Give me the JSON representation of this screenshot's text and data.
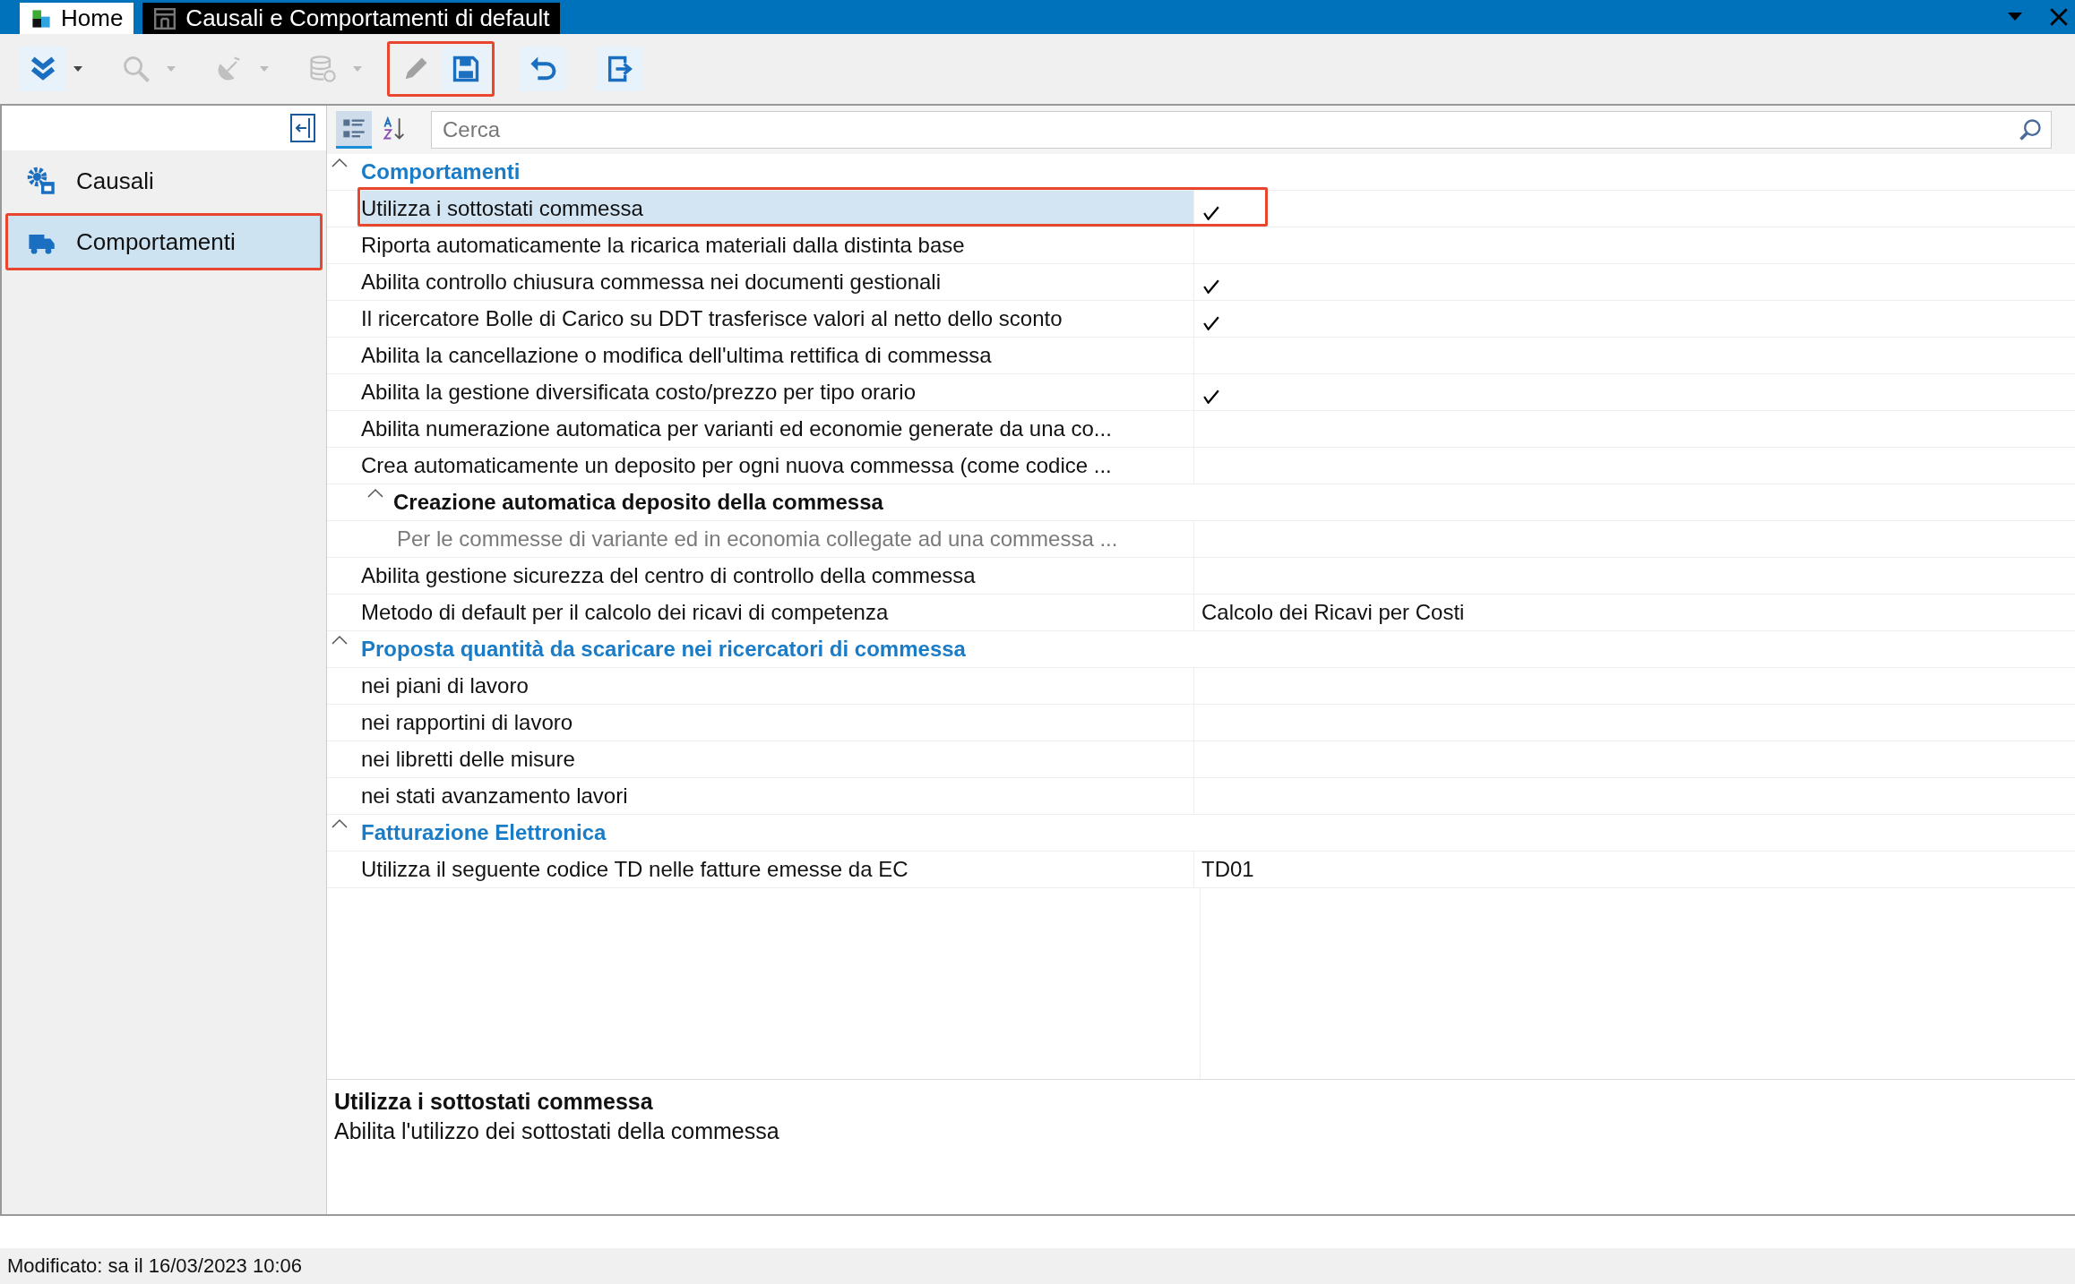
{
  "window": {
    "tabs": [
      {
        "label": "Home",
        "selected": false
      },
      {
        "label": "Causali e Comportamenti di default",
        "selected": true
      }
    ]
  },
  "toolbar": {
    "groups": [
      {
        "highlighted": false,
        "buttons": [
          {
            "kind": "expand",
            "dropdown": true,
            "disabled": false
          }
        ]
      },
      {
        "highlighted": false,
        "buttons": [
          {
            "kind": "search",
            "dropdown": true,
            "disabled": true
          }
        ]
      },
      {
        "highlighted": false,
        "buttons": [
          {
            "kind": "dish",
            "dropdown": true,
            "disabled": true
          }
        ]
      },
      {
        "highlighted": false,
        "buttons": [
          {
            "kind": "database",
            "dropdown": true,
            "disabled": true
          }
        ]
      },
      {
        "highlighted": true,
        "buttons": [
          {
            "kind": "edit",
            "disabled": true
          },
          {
            "kind": "save",
            "disabled": false
          }
        ]
      },
      {
        "highlighted": false,
        "buttons": [
          {
            "kind": "undo",
            "disabled": false
          }
        ]
      },
      {
        "highlighted": false,
        "buttons": [
          {
            "kind": "exit",
            "disabled": false
          }
        ]
      }
    ]
  },
  "sidebar": {
    "items": [
      {
        "label": "Causali",
        "kind": "gear",
        "selected": false,
        "highlighted": false
      },
      {
        "label": "Comportamenti",
        "kind": "truck",
        "selected": true,
        "highlighted": true
      }
    ]
  },
  "grid": {
    "views": [
      {
        "kind": "categorized",
        "selected": true
      },
      {
        "kind": "alphabetical",
        "selected": false
      }
    ],
    "search": {
      "placeholder": "Cerca"
    },
    "categories": [
      {
        "title": "Comportamenti",
        "expanded": true,
        "rows": [
          {
            "kind": "check",
            "label": "Utilizza i sottostati commessa",
            "checked": true,
            "selected": true,
            "highlighted": true
          },
          {
            "kind": "check",
            "label": "Riporta automaticamente la ricarica materiali dalla distinta base",
            "checked": false,
            "selected": false,
            "highlighted": false
          },
          {
            "kind": "check",
            "label": "Abilita controllo chiusura commessa nei documenti gestionali",
            "checked": true,
            "selected": false,
            "highlighted": false
          },
          {
            "kind": "check",
            "label": "Il ricercatore Bolle di Carico su DDT trasferisce valori al netto dello sconto",
            "checked": true,
            "selected": false,
            "highlighted": false
          },
          {
            "kind": "check",
            "label": "Abilita la cancellazione o modifica dell'ultima rettifica di commessa",
            "checked": false,
            "selected": false,
            "highlighted": false
          },
          {
            "kind": "check",
            "label": "Abilita la gestione diversificata costo/prezzo per tipo orario",
            "checked": true,
            "selected": false,
            "highlighted": false
          },
          {
            "kind": "check",
            "label": "Abilita numerazione automatica per varianti ed economie generate da una co...",
            "checked": false,
            "selected": false,
            "highlighted": false
          },
          {
            "kind": "check",
            "label": "Crea automaticamente un deposito per ogni nuova commessa (come codice ...",
            "checked": false,
            "selected": false,
            "highlighted": false
          },
          {
            "kind": "group",
            "label": "Creazione automatica deposito della commessa",
            "expanded": true,
            "children": [
              {
                "label": "Per le commesse di variante ed in economia collegate ad una commessa ...",
                "disabled": true
              }
            ]
          },
          {
            "kind": "check",
            "label": "Abilita gestione sicurezza del centro di controllo della commessa",
            "checked": false,
            "selected": false,
            "highlighted": false
          },
          {
            "kind": "value",
            "label": "Metodo di default per il calcolo dei ricavi di competenza",
            "value": "Calcolo dei Ricavi per Costi",
            "selected": false,
            "highlighted": false
          }
        ]
      },
      {
        "title": "Proposta quantità da scaricare nei ricercatori di commessa",
        "expanded": true,
        "rows": [
          {
            "kind": "check",
            "label": "nei piani di lavoro",
            "checked": false,
            "selected": false,
            "highlighted": false
          },
          {
            "kind": "check",
            "label": "nei rapportini di lavoro",
            "checked": false,
            "selected": false,
            "highlighted": false
          },
          {
            "kind": "check",
            "label": "nei libretti delle misure",
            "checked": false,
            "selected": false,
            "highlighted": false
          },
          {
            "kind": "check",
            "label": "nei stati avanzamento lavori",
            "checked": false,
            "selected": false,
            "highlighted": false
          }
        ]
      },
      {
        "title": "Fatturazione Elettronica",
        "expanded": true,
        "rows": [
          {
            "kind": "value",
            "label": "Utilizza il seguente codice TD nelle fatture emesse da EC",
            "value": "TD01",
            "selected": false,
            "highlighted": false
          }
        ]
      }
    ]
  },
  "description": {
    "title": "Utilizza i sottostati commessa",
    "text": "Abilita l'utilizzo dei sottostati della commessa"
  },
  "status_bar": {
    "text": "Modificato: sa il 16/03/2023 10:06"
  }
}
